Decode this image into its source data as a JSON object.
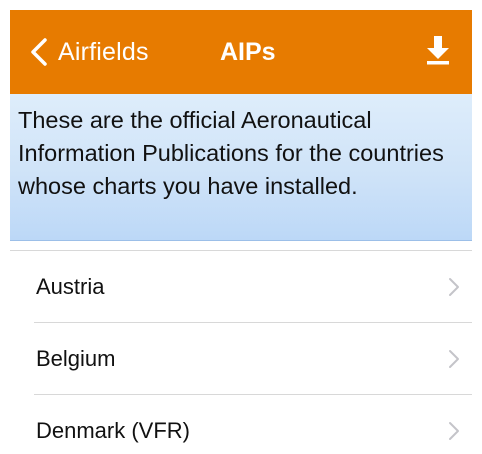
{
  "nav": {
    "back_label": "Airfields",
    "title": "AIPs",
    "download_icon": "download-icon",
    "back_icon": "chevron-left-icon",
    "bar_color": "#e77b00"
  },
  "banner": {
    "text": "These are the official Aeronautical Information Publications for the countries whose charts you have installed."
  },
  "list": {
    "items": [
      {
        "label": "Austria"
      },
      {
        "label": "Belgium"
      },
      {
        "label": "Denmark (VFR)"
      }
    ]
  }
}
